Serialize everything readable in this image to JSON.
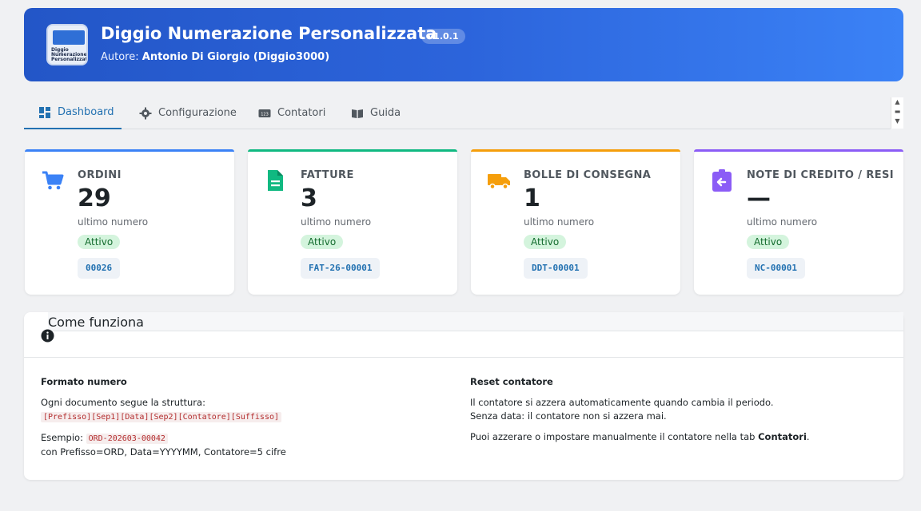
{
  "header": {
    "title": "Diggio Numerazione Personalizzata",
    "version": "v1.0.1",
    "author_prefix": "Autore:",
    "author_name": "Antonio Di Giorgio (Diggio3000)",
    "logo_text": "Diggio Numerazione Personalizzata"
  },
  "tabs": [
    {
      "label": "Dashboard",
      "icon": "dashboard-icon",
      "active": true
    },
    {
      "label": "Configurazione",
      "icon": "gear-icon",
      "active": false
    },
    {
      "label": "Contatori",
      "icon": "counter-icon",
      "active": false
    },
    {
      "label": "Guida",
      "icon": "book-icon",
      "active": false
    }
  ],
  "cards": [
    {
      "label": "ORDINI",
      "value": "29",
      "sublabel": "ultimo numero",
      "status": "Attivo",
      "code": "00026",
      "color": "#3b82f6",
      "icon": "cart-icon"
    },
    {
      "label": "FATTURE",
      "value": "3",
      "sublabel": "ultimo numero",
      "status": "Attivo",
      "code": "FAT-26-00001",
      "color": "#10b981",
      "icon": "document-icon"
    },
    {
      "label": "BOLLE DI CONSEGNA",
      "value": "1",
      "sublabel": "ultimo numero",
      "status": "Attivo",
      "code": "DDT-00001",
      "color": "#f59e0b",
      "icon": "truck-icon"
    },
    {
      "label": "NOTE DI CREDITO / RESI",
      "value": "—",
      "sublabel": "ultimo numero",
      "status": "Attivo",
      "code": "NC-00001",
      "color": "#8b5cf6",
      "icon": "return-icon"
    }
  ],
  "info": {
    "title": "Come funziona",
    "left": {
      "heading": "Formato numero",
      "structure_text": "Ogni documento segue la struttura:",
      "structure_code": "[Prefisso][Sep1][Data][Sep2][Contatore][Suffisso]",
      "example_label": "Esempio:",
      "example_code": "ORD-202603-00042",
      "example_desc": "con Prefisso=ORD, Data=YYYYMM, Contatore=5 cifre"
    },
    "right": {
      "heading": "Reset contatore",
      "line1": "Il contatore si azzera automaticamente quando cambia il periodo.",
      "line2": "Senza data: il contatore non si azzera mai.",
      "line3_prefix": "Puoi azzerare o impostare manualmente il contatore nella tab",
      "line3_bold": "Contatori",
      "line3_suffix": "."
    }
  }
}
